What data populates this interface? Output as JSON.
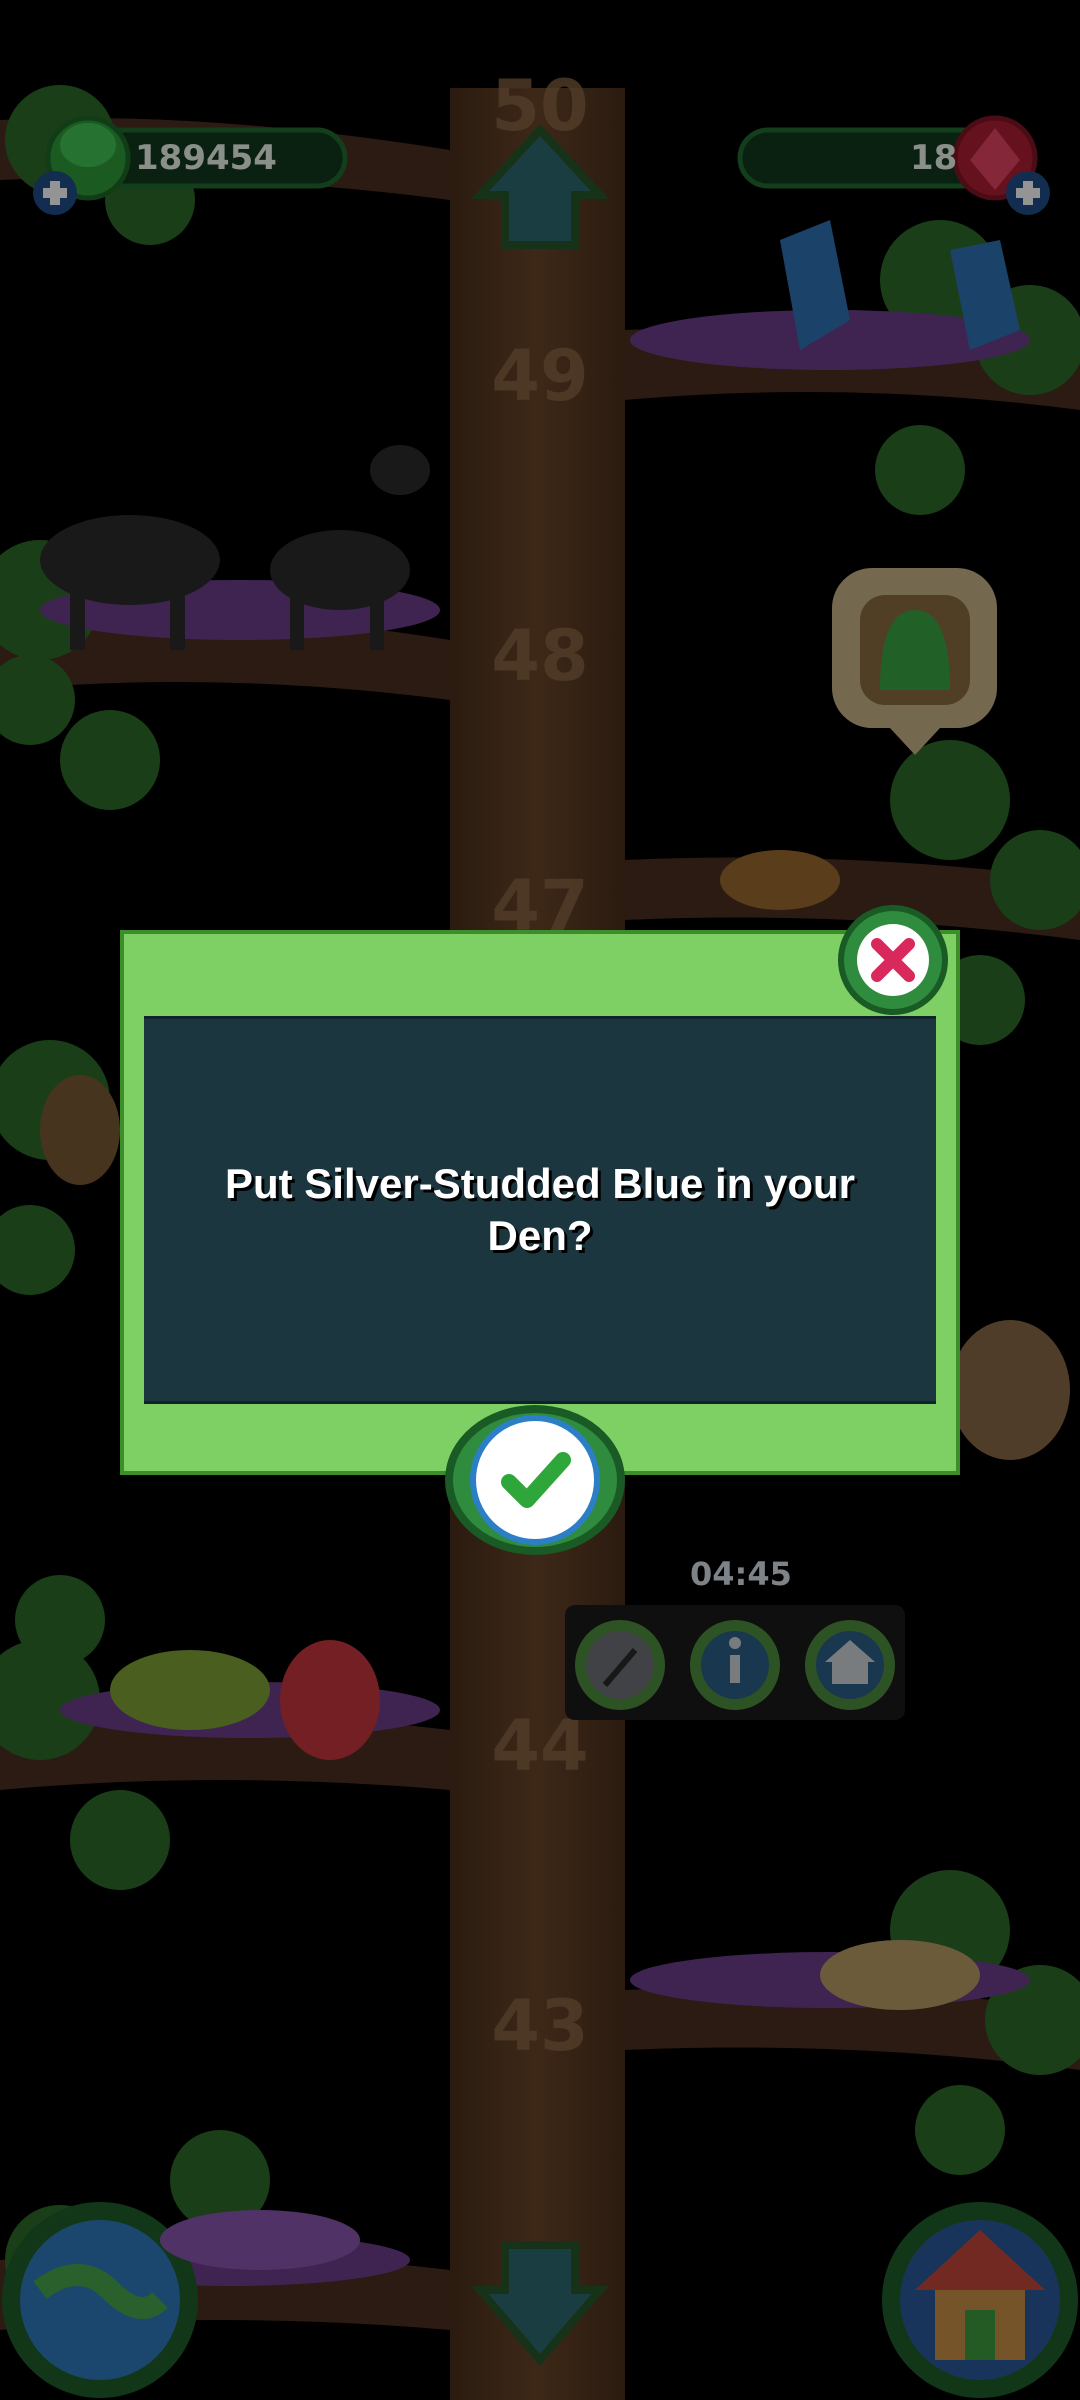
{
  "hud": {
    "coins": "189454",
    "gems": "18"
  },
  "branch_numbers": [
    "50",
    "49",
    "48",
    "47",
    "44",
    "43"
  ],
  "dialog": {
    "message": "Put Silver-Studded Blue in your Den?"
  },
  "timer": "04:45",
  "colors": {
    "dialog_green": "#7ed065",
    "dialog_dark": "#1c3640",
    "trunk": "#5a3a22"
  }
}
